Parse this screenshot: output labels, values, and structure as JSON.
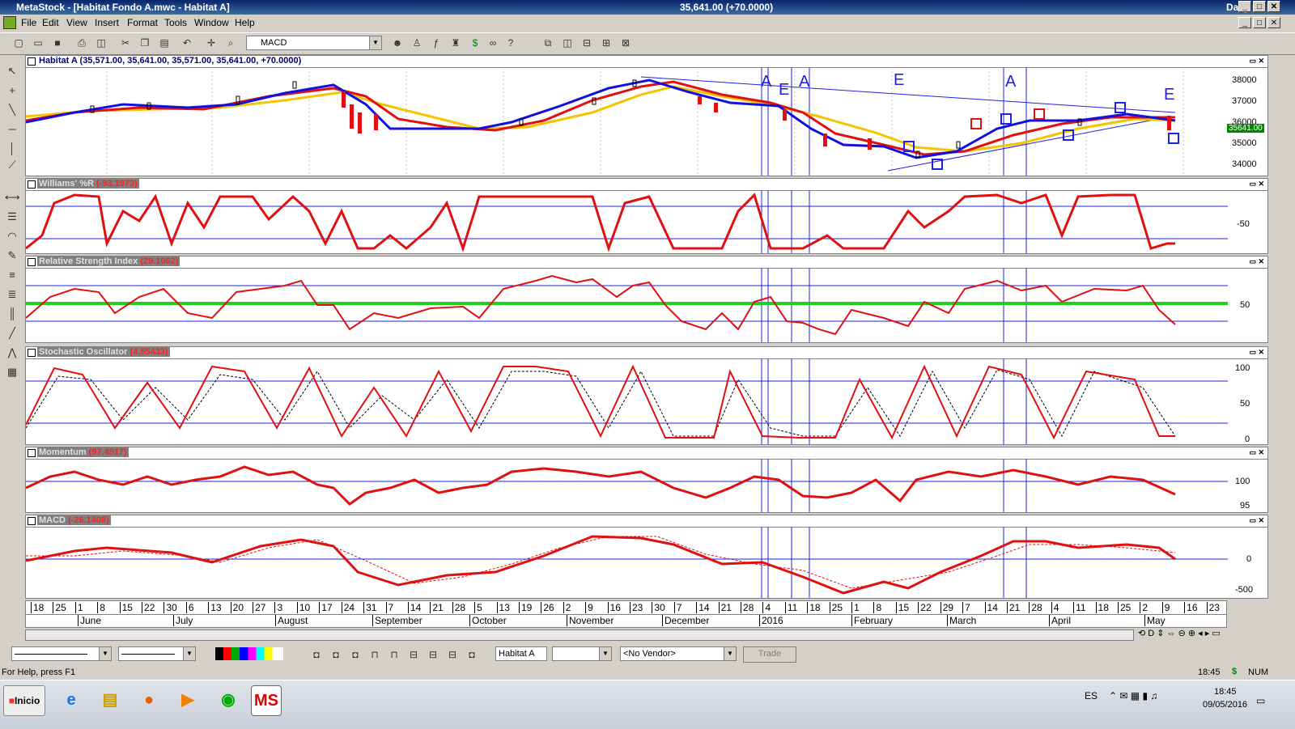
{
  "window": {
    "app": "MetaStock",
    "title": "MetaStock - [Habitat Fondo A.mwc - Habitat A]",
    "center": "35,641.00 (+70.0000)",
    "period": "Daily"
  },
  "menu": [
    "File",
    "Edit",
    "View",
    "Insert",
    "Format",
    "Tools",
    "Window",
    "Help"
  ],
  "toolbar": {
    "indicator": "MACD"
  },
  "panels": {
    "price": {
      "name": "Habitat A",
      "values": "(35,571.00, 35,641.00, 35,571.00, 35,641.00, +70.0000)",
      "ticks": [
        "38000",
        "37000",
        "36000",
        "35000",
        "34000"
      ],
      "last": "35641.00",
      "markers": [
        "A",
        "E",
        "A",
        "E",
        "A",
        "E"
      ]
    },
    "williams": {
      "name": "Williams' %R",
      "value": "(-93.1973)",
      "ticks": [
        "-50"
      ]
    },
    "rsi": {
      "name": "Relative Strength Index",
      "value": "(29.1062)",
      "ticks": [
        "50"
      ]
    },
    "stoch": {
      "name": "Stochastic Oscillator",
      "value": "(4.55433)",
      "ticks": [
        "100",
        "50",
        "0"
      ]
    },
    "momentum": {
      "name": "Momentum",
      "value": "(97.4517)",
      "ticks": [
        "100",
        "95"
      ]
    },
    "macd": {
      "name": "MACD",
      "value": "(-26.1408)",
      "ticks": [
        "0",
        "-500"
      ]
    }
  },
  "xaxis": {
    "days": [
      "18",
      "25",
      "1",
      "8",
      "15",
      "22",
      "30",
      "6",
      "13",
      "20",
      "27",
      "3",
      "10",
      "17",
      "24",
      "31",
      "7",
      "14",
      "21",
      "28",
      "5",
      "13",
      "19",
      "26",
      "2",
      "9",
      "16",
      "23",
      "30",
      "7",
      "14",
      "21",
      "28",
      "4",
      "11",
      "18",
      "25",
      "1",
      "8",
      "15",
      "22",
      "29",
      "7",
      "14",
      "21",
      "28",
      "4",
      "11",
      "18",
      "25",
      "2",
      "9",
      "16",
      "23"
    ],
    "months": [
      "June",
      "July",
      "August",
      "September",
      "October",
      "November",
      "December",
      "2016",
      "February",
      "March",
      "April",
      "May"
    ]
  },
  "bottom": {
    "security": "Habitat A",
    "vendor": "<No Vendor>",
    "trade": "Trade"
  },
  "status": {
    "help": "For Help, press F1",
    "time": "18:45",
    "mode": "NUM"
  },
  "taskbar": {
    "start": "Inicio",
    "lang": "ES",
    "clock_time": "18:45",
    "clock_date": "09/05/2016"
  }
}
